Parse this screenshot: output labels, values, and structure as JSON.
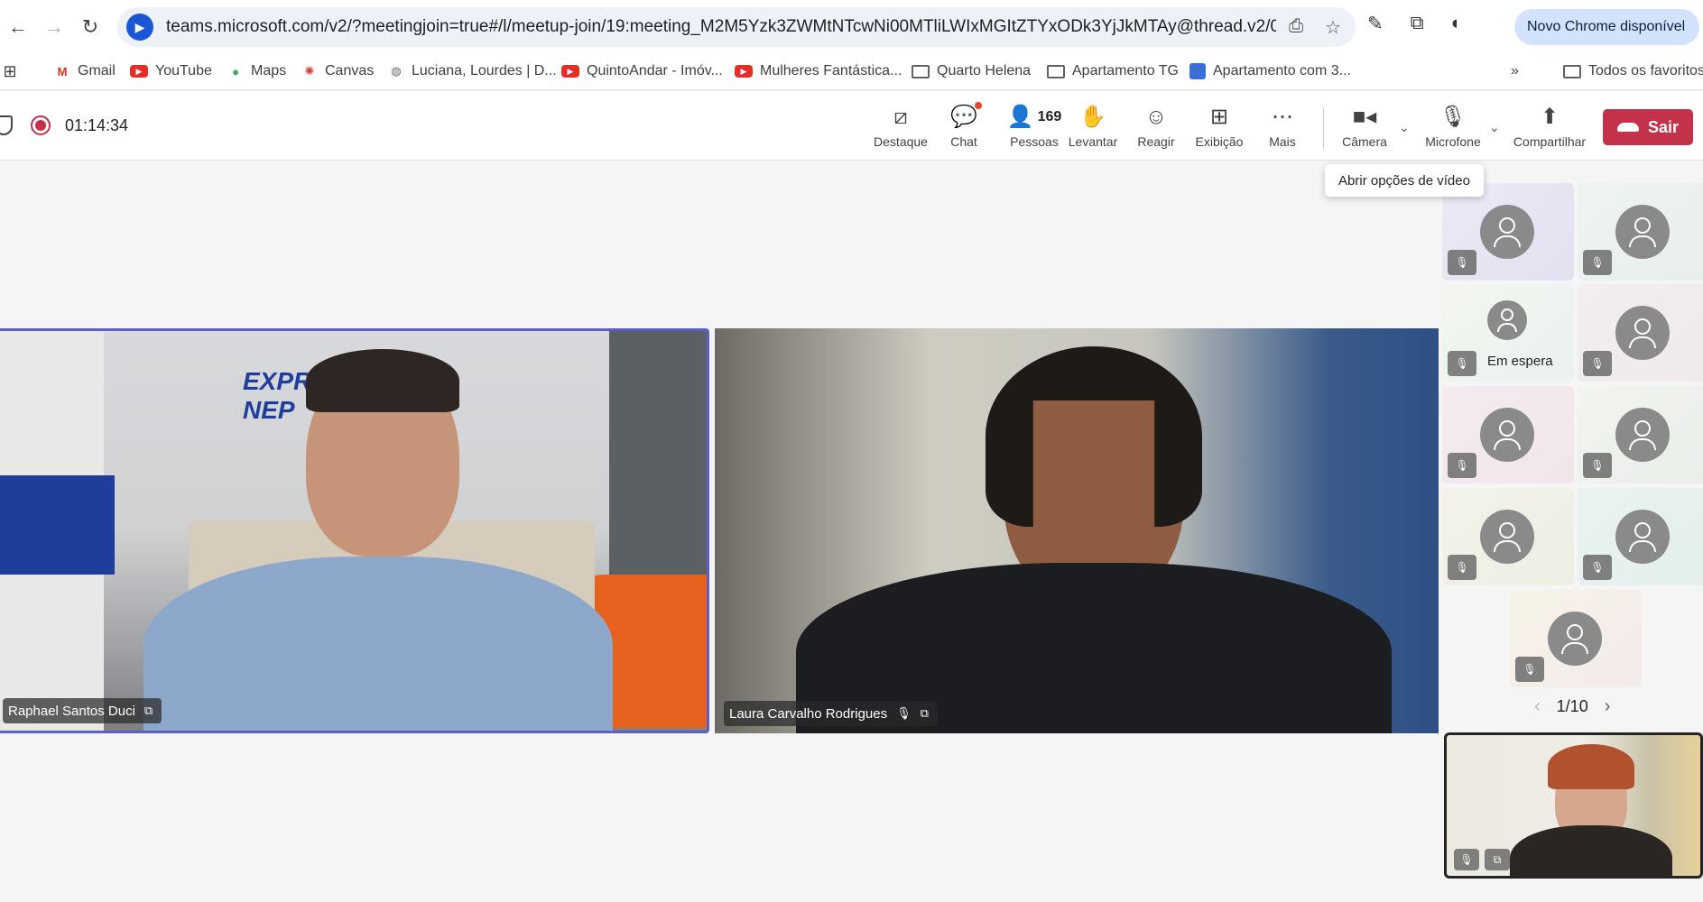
{
  "browser": {
    "url": "teams.microsoft.com/v2/?meetingjoin=true#/l/meetup-join/19:meeting_M2M5Yzk3ZWMtNTcwNi00MTliLWIxMGItZTYxODk3YjJkMTAy@thread.v2/0?context=...",
    "update_label": "Novo Chrome disponível",
    "bookmarks": [
      "Gmail",
      "YouTube",
      "Maps",
      "Canvas",
      "Luciana, Lourdes | D...",
      "QuintoAndar - Imóv...",
      "Mulheres Fantástica...",
      "Quarto Helena",
      "Apartamento TG",
      "Apartamento com 3..."
    ],
    "all_bookmarks": "Todos os favoritos",
    "overflow": "»"
  },
  "meeting": {
    "timer": "01:14:34",
    "toolbar": {
      "destaque": "Destaque",
      "chat": "Chat",
      "people_count": "169",
      "pessoas": "Pessoas",
      "levantar": "Levantar",
      "reagir": "Reagir",
      "exibicao": "Exibição",
      "mais": "Mais",
      "camera": "Câmera",
      "microfone": "Microfone",
      "compartilhar": "Compartilhar",
      "sair": "Sair"
    },
    "tooltip": "Abrir opções de vídeo",
    "participants": {
      "main1": "Raphael Santos Duci",
      "main2": "Laura Carvalho Rodrigues"
    },
    "waiting_label": "Em espera",
    "pager": "1/10"
  },
  "colors": {
    "leave": "#c4314b",
    "active_speaker": "#5b5fc7",
    "record": "#c4314b"
  },
  "icons": [
    "back-icon",
    "forward-icon",
    "reload-icon",
    "install-icon",
    "star-icon",
    "eyedropper-icon",
    "extensions-icon",
    "spotlight-icon",
    "chat-icon",
    "people-icon",
    "raise-hand-icon",
    "react-icon",
    "view-icon",
    "more-icon",
    "camera-icon",
    "mic-off-icon",
    "share-icon",
    "phone-icon"
  ]
}
